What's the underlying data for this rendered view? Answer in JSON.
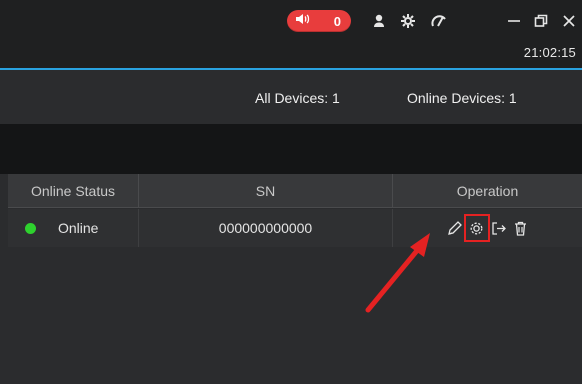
{
  "titlebar": {
    "alarm_count": "0",
    "clock": "21:02:15",
    "icons": [
      "speaker-icon",
      "user-icon",
      "settings-icon",
      "performance-icon",
      "minimize-icon",
      "restore-icon",
      "close-icon"
    ],
    "minimize_label": "—",
    "restore_label": "❐",
    "close_label": "✕"
  },
  "summary": {
    "all_devices": "All Devices:  1",
    "online_devices": "Online Devices:  1"
  },
  "table": {
    "columns": [
      "Online Status",
      "SN",
      "Operation"
    ],
    "rows": [
      {
        "status": "Online",
        "sn": "000000000000",
        "operations": [
          "edit-icon",
          "settings-icon",
          "logout-icon",
          "delete-icon"
        ]
      }
    ]
  },
  "colors": {
    "accent": "#2aa3e0",
    "alarm": "#e83d3d",
    "online": "#2ed12e",
    "highlight": "#e52222"
  }
}
